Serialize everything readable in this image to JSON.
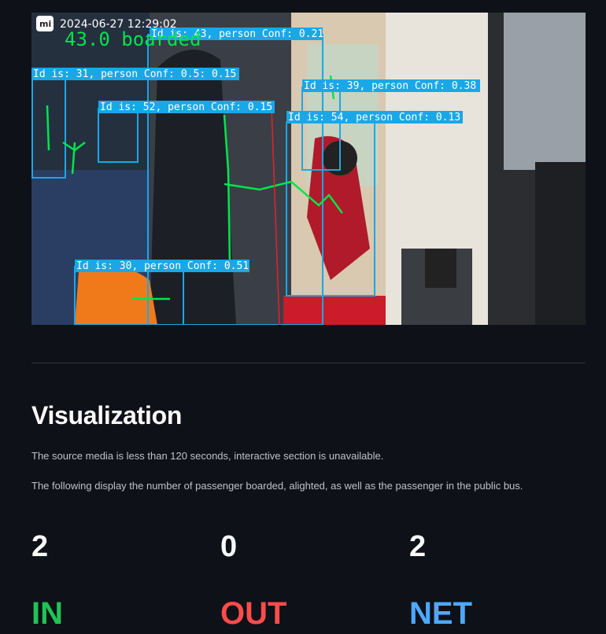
{
  "video": {
    "timestamp": "2024-06-27  12:29:02",
    "overlay_counter": "43.0 boarded",
    "detections": [
      {
        "label": "Id is: 43, person Conf: 0.21"
      },
      {
        "label": "Id is: 31, person Conf: 0.5: 0.15"
      },
      {
        "label": "Id is: 52, person Conf: 0.15"
      },
      {
        "label": "Id is: 39, person Conf: 0.38"
      },
      {
        "label": "Id is: 54, person Conf: 0.13"
      },
      {
        "label": "Id is: 30, person Conf: 0.51"
      }
    ]
  },
  "section": {
    "heading": "Visualization",
    "note": "The source media is less than 120 seconds, interactive section is unavailable.",
    "description": "The following display the number of passenger boarded, alighted, as well as the passenger in the public bus."
  },
  "metrics": [
    {
      "value": "2",
      "label": "IN",
      "color": "#21c354"
    },
    {
      "value": "0",
      "label": "OUT",
      "color": "#ff4b4b"
    },
    {
      "value": "2",
      "label": "NET",
      "color": "#4da8ff"
    }
  ],
  "colors": {
    "background": "#0e1117",
    "bbox": "#1aa7e8",
    "track": "#00e64d"
  }
}
